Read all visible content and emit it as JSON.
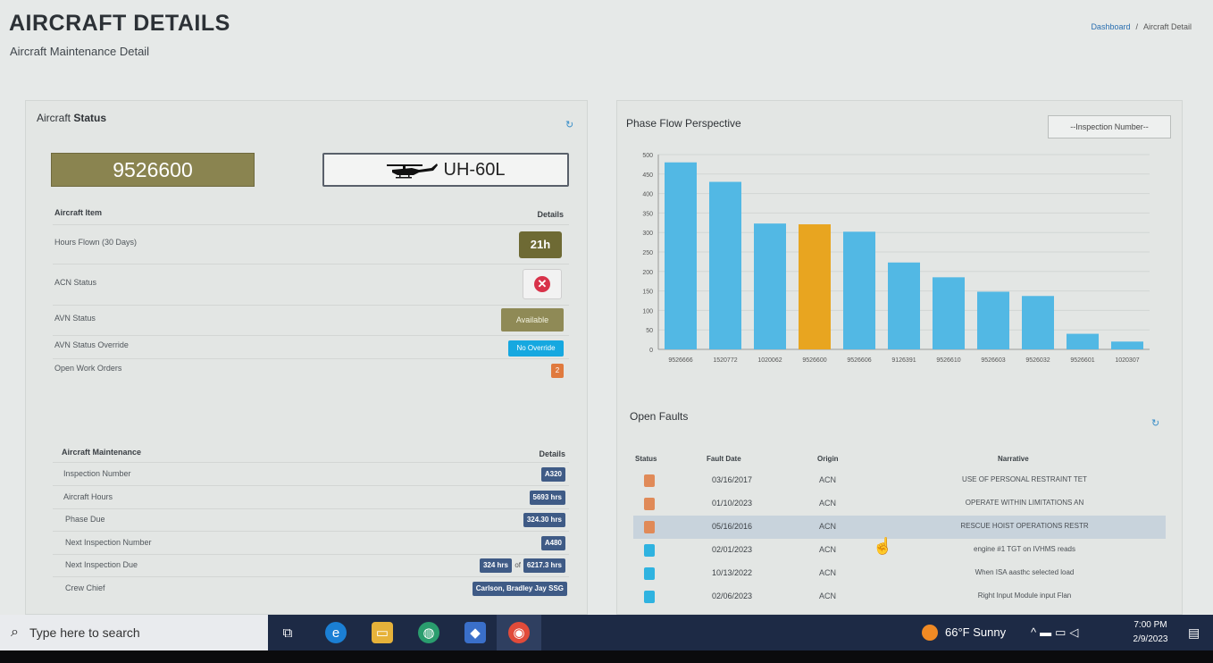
{
  "header": {
    "title": "AIRCRAFT DETAILS",
    "subtitle": "Aircraft Maintenance Detail",
    "breadcrumb": {
      "link": "Dashboard",
      "separator": "/",
      "current": "Aircraft Detail"
    }
  },
  "aircraft_status": {
    "title_prefix": "Aircraft",
    "title_bold": "Status",
    "tail_number": "9526600",
    "aircraft_type": "UH-60L",
    "col_item": "Aircraft Item",
    "col_details": "Details",
    "rows": {
      "hours_flown": {
        "label": "Hours Flown (30 Days)",
        "value": "21h"
      },
      "acn_status": {
        "label": "ACN Status"
      },
      "avn_status": {
        "label": "AVN Status",
        "value": "Available"
      },
      "avn_override": {
        "label": "AVN Status Override",
        "value": "No Override"
      },
      "open_wo": {
        "label": "Open Work Orders",
        "value": "2"
      }
    }
  },
  "aircraft_maintenance": {
    "col_item": "Aircraft Maintenance",
    "col_details": "Details",
    "rows": {
      "inspection_number": {
        "label": "Inspection Number",
        "value": "A320"
      },
      "aircraft_hours": {
        "label": "Aircraft Hours",
        "value": "5693 hrs"
      },
      "phase_due": {
        "label": "Phase Due",
        "value": "324.30 hrs"
      },
      "next_inspection_number": {
        "label": "Next Inspection Number",
        "value": "A480"
      },
      "next_inspection_due": {
        "label": "Next Inspection Due",
        "value_a": "324 hrs",
        "of": "of",
        "value_b": "6217.3 hrs"
      },
      "crew_chief": {
        "label": "Crew Chief",
        "value": "Carlson, Bradley Jay SSG"
      }
    }
  },
  "phase_flow": {
    "title": "Phase Flow Perspective",
    "inspection_select": "--Inspection Number--"
  },
  "chart_data": {
    "type": "bar",
    "title": "Phase Flow Perspective",
    "categories": [
      "9526666",
      "1520772",
      "1020062",
      "9526600",
      "9526606",
      "9126391",
      "9526610",
      "9526603",
      "9526032",
      "9526601",
      "1020307"
    ],
    "values": [
      480,
      430,
      323,
      321,
      302,
      223,
      185,
      148,
      137,
      40,
      20
    ],
    "highlight_index": 3,
    "colors": {
      "default": "#52b8e4",
      "highlight": "#e8a520"
    },
    "ylim": [
      0,
      500
    ],
    "yticks": [
      0,
      50,
      100,
      150,
      200,
      250,
      300,
      350,
      400,
      450,
      500
    ],
    "grid": true
  },
  "open_faults": {
    "title": "Open Faults",
    "headers": {
      "status": "Status",
      "fault_date": "Fault Date",
      "origin": "Origin",
      "narrative": "Narrative"
    },
    "rows": [
      {
        "status_color": "#e08a58",
        "date": "03/16/2017",
        "origin": "ACN",
        "narrative": "USE OF PERSONAL RESTRAINT TET"
      },
      {
        "status_color": "#e08a58",
        "date": "01/10/2023",
        "origin": "ACN",
        "narrative": "OPERATE WITHIN LIMITATIONS AN"
      },
      {
        "status_color": "#e08a58",
        "date": "05/16/2016",
        "origin": "ACN",
        "narrative": "RESCUE HOIST OPERATIONS RESTR"
      },
      {
        "status_color": "#2fb3e0",
        "date": "02/01/2023",
        "origin": "ACN",
        "narrative": "engine #1 TGT on IVHMS reads"
      },
      {
        "status_color": "#2fb3e0",
        "date": "10/13/2022",
        "origin": "ACN",
        "narrative": "When ISA aasthc selected load"
      },
      {
        "status_color": "#2fb3e0",
        "date": "02/06/2023",
        "origin": "ACN",
        "narrative": "Right Input Module input Flan"
      }
    ]
  },
  "taskbar": {
    "search_placeholder": "Type here to search",
    "weather": "66°F  Sunny",
    "time": "7:00 PM",
    "date": "2/9/2023"
  }
}
